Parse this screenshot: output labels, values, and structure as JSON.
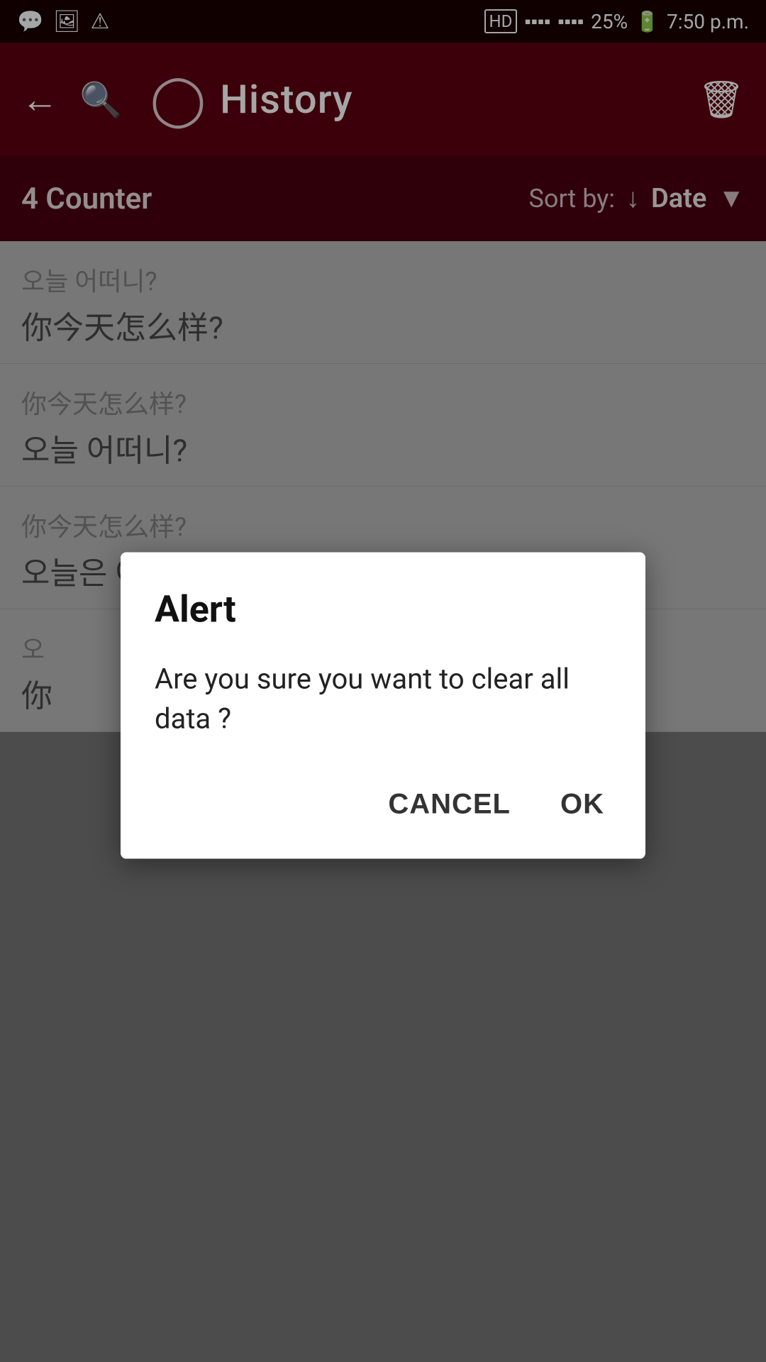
{
  "statusBar": {
    "leftIcons": [
      "whatsapp-icon",
      "image-icon",
      "alert-icon"
    ],
    "signal": "HD ▪ ▪▪▪ ▪▪▪",
    "battery": "25%",
    "time": "7:50 p.m."
  },
  "toolbar": {
    "title": "History",
    "backLabel": "←",
    "searchLabel": "🔍",
    "clockSymbol": "⏱",
    "trashSymbol": "🗑"
  },
  "subheader": {
    "counter": "4 Counter",
    "sortByLabel": "Sort by:",
    "sortValue": "Date"
  },
  "listItems": [
    {
      "top": "오늘 어떠니?",
      "bottom": "你今天怎么样?"
    },
    {
      "top": "你今天怎么样?",
      "bottom": "오늘 어떠니?"
    },
    {
      "top": "你今天怎么样?",
      "bottom": "오늘은 어떠세요?"
    },
    {
      "top": "오",
      "bottom": "你"
    }
  ],
  "dialog": {
    "title": "Alert",
    "message": "Are you sure you want to clear all data ?",
    "cancelLabel": "CANCEL",
    "okLabel": "OK"
  }
}
